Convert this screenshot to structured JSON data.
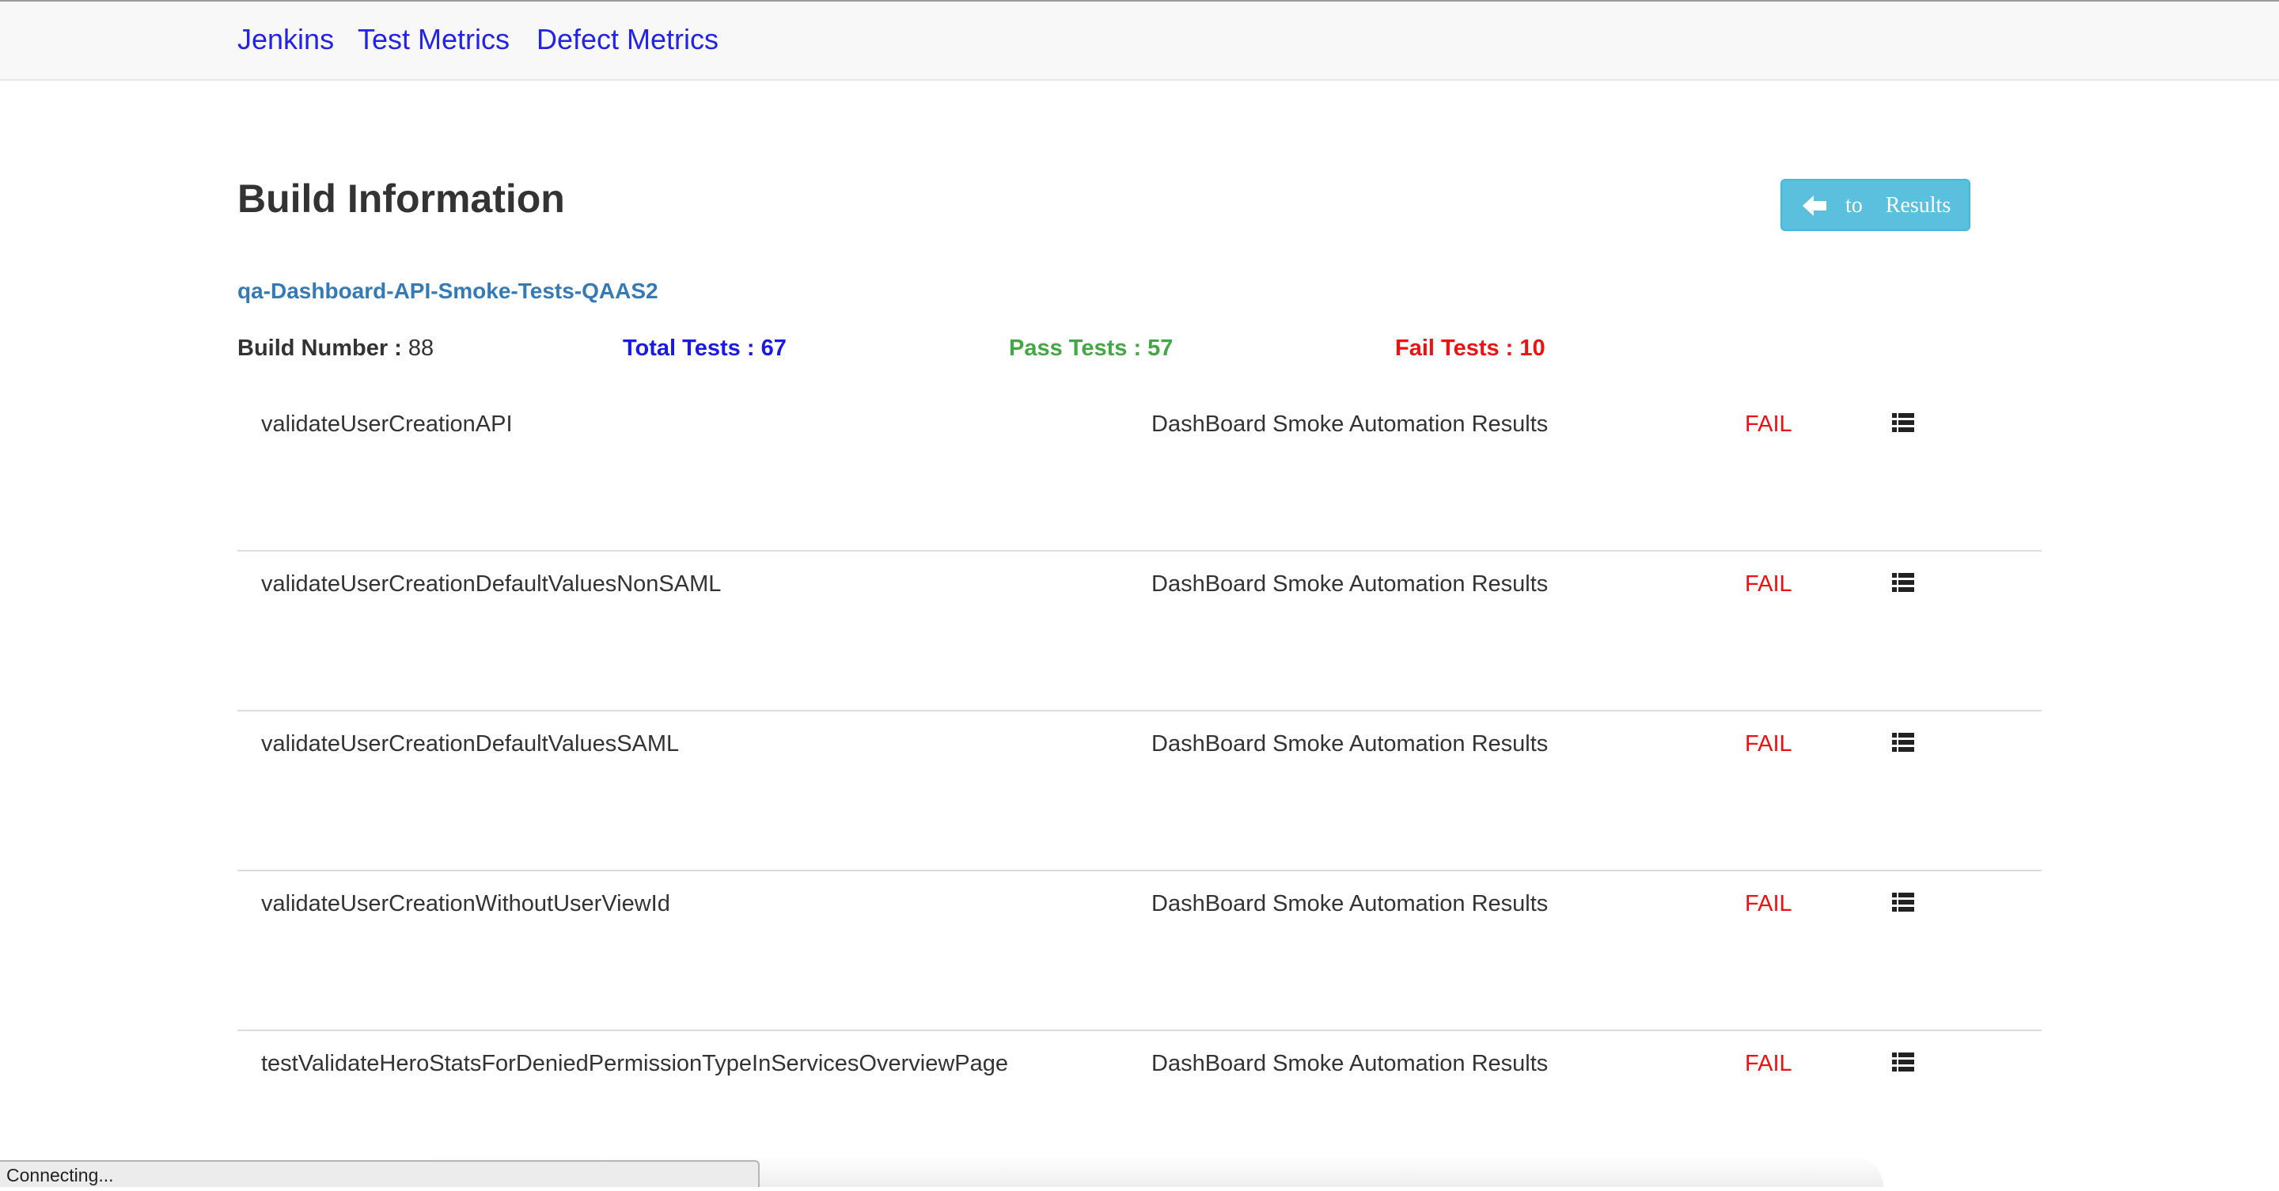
{
  "nav": {
    "items": [
      {
        "label": "Jenkins"
      },
      {
        "label": "Test Metrics"
      },
      {
        "label": "Defect Metrics"
      }
    ]
  },
  "header": {
    "title": "Build Information",
    "back_button": {
      "label": "to Results",
      "icon": "arrow-left-icon"
    }
  },
  "build": {
    "job_name": "qa-Dashboard-API-Smoke-Tests-QAAS2",
    "stats": {
      "build_label": "Build Number : ",
      "build_value": "88",
      "total_label": "Total Tests : ",
      "total_value": "67",
      "pass_label": "Pass Tests : ",
      "pass_value": "57",
      "fail_label": "Fail Tests : ",
      "fail_value": "10"
    }
  },
  "results": [
    {
      "name": "validateUserCreationAPI",
      "suite": "DashBoard Smoke Automation Results",
      "status": "FAIL",
      "icon": "list-icon"
    },
    {
      "name": "validateUserCreationDefaultValuesNonSAML",
      "suite": "DashBoard Smoke Automation Results",
      "status": "FAIL",
      "icon": "list-icon"
    },
    {
      "name": "validateUserCreationDefaultValuesSAML",
      "suite": "DashBoard Smoke Automation Results",
      "status": "FAIL",
      "icon": "list-icon"
    },
    {
      "name": "validateUserCreationWithoutUserViewId",
      "suite": "DashBoard Smoke Automation Results",
      "status": "FAIL",
      "icon": "list-icon"
    },
    {
      "name": "testValidateHeroStatsForDeniedPermissionTypeInServicesOverviewPage",
      "suite": "DashBoard Smoke Automation Results",
      "status": "FAIL",
      "icon": "list-icon"
    }
  ],
  "status_bar": {
    "text": "Connecting..."
  },
  "colors": {
    "nav_link": "#2323e8",
    "job_link": "#337ab7",
    "total": "#1a1ae6",
    "pass": "#43a843",
    "fail": "#ee1111",
    "button": "#5bc0de"
  }
}
